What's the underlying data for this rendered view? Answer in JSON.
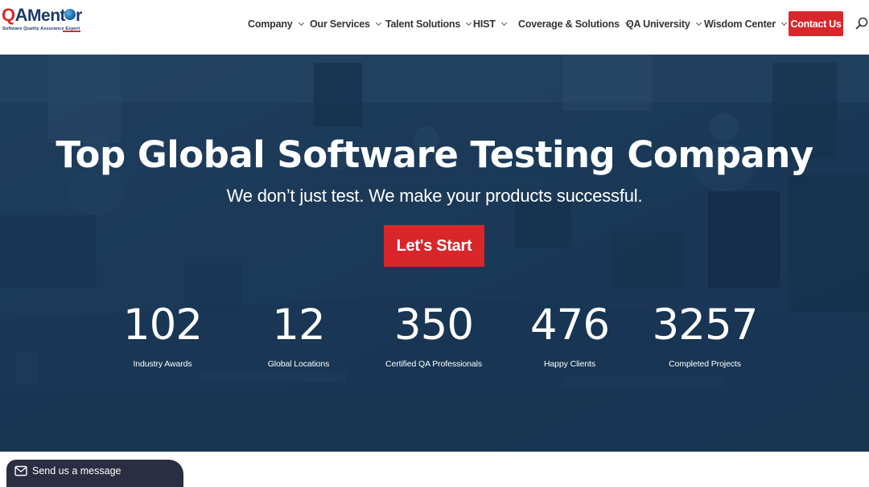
{
  "logo": {
    "q": "Q",
    "a": "A",
    "mentor": "Ment",
    "mentor_end": "r",
    "tagline": "Software Quality Assurance Expert"
  },
  "nav": {
    "items": [
      {
        "label": "Company"
      },
      {
        "label": "Our Services"
      },
      {
        "label": "Talent Solutions"
      },
      {
        "label": "HIST"
      },
      {
        "label": "Coverage & Solutions"
      },
      {
        "label": "QA University"
      },
      {
        "label": "Wisdom Center"
      }
    ],
    "contact_label": "Contact Us",
    "search_icon": "search-icon"
  },
  "hero": {
    "title": "Top Global Software Testing Company",
    "subtitle": "We don’t just test. We make your products successful.",
    "cta_label": "Let's Start",
    "stats": [
      {
        "number": "102",
        "label": "Industry Awards"
      },
      {
        "number": "12",
        "label": "Global Locations"
      },
      {
        "number": "350",
        "label": "Certified QA Professionals"
      },
      {
        "number": "476",
        "label": "Happy Clients"
      },
      {
        "number": "3257",
        "label": "Completed Projects"
      }
    ]
  },
  "message_widget": {
    "label": "Send us a message",
    "icon": "envelope-icon"
  },
  "colors": {
    "brand_red": "#d9262b",
    "brand_navy": "#1b3a6b",
    "hero_overlay": "#163452",
    "widget_bg": "#2b2d42"
  }
}
